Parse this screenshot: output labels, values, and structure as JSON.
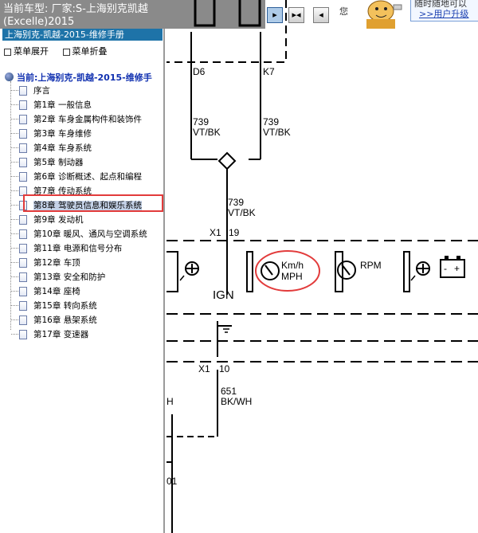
{
  "window": {
    "title_line1": "当前车型:  厂家:S-上海别克凯越",
    "title_line2": "(Excelle)2015"
  },
  "toolbar": {
    "buttons": [
      "▸",
      "▸◂",
      "◂"
    ]
  },
  "ad": {
    "side_text": "您",
    "line1": "随时随地可以",
    "line2": ">>用户升级"
  },
  "sidebar": {
    "header": "上海别克-凯越-2015-维修手册",
    "expand_label": "菜单展开",
    "collapse_label": "菜单折叠",
    "root": "当前:上海别克-凯越-2015-维修手",
    "items": [
      "序言",
      "第1章  一般信息",
      "第2章  车身金属构件和装饰件",
      "第3章  车身维修",
      "第4章  车身系统",
      "第5章  制动器",
      "第6章  诊断概述、起点和编程",
      "第7章  传动系统",
      "第8章  驾驶员信息和娱乐系统",
      "第9章  发动机",
      "第10章  暖风、通风与空调系统",
      "第11章  电源和信号分布",
      "第12章  车顶",
      "第13章  安全和防护",
      "第14章  座椅",
      "第15章  转向系统",
      "第16章  悬架系统",
      "第17章  变速器"
    ],
    "selected_index": 8
  },
  "diagram": {
    "pin_left": "D6",
    "pin_right": "K7",
    "wire_left": "739",
    "wire_left_color": "VT/BK",
    "wire_right": "739",
    "wire_right_color": "VT/BK",
    "wire_mid": "739",
    "wire_mid_color": "VT/BK",
    "conn1": "X1",
    "pin1": "19",
    "gauge_speed_line1": "Km/h",
    "gauge_speed_line2": "MPH",
    "gauge_rpm": "RPM",
    "ign_label": "IGN",
    "conn2": "X1",
    "pin2": "10",
    "wire_bottom": "651",
    "wire_bottom_color": "BK/WH",
    "left_edge_h": "H",
    "left_edge_num": "01"
  }
}
